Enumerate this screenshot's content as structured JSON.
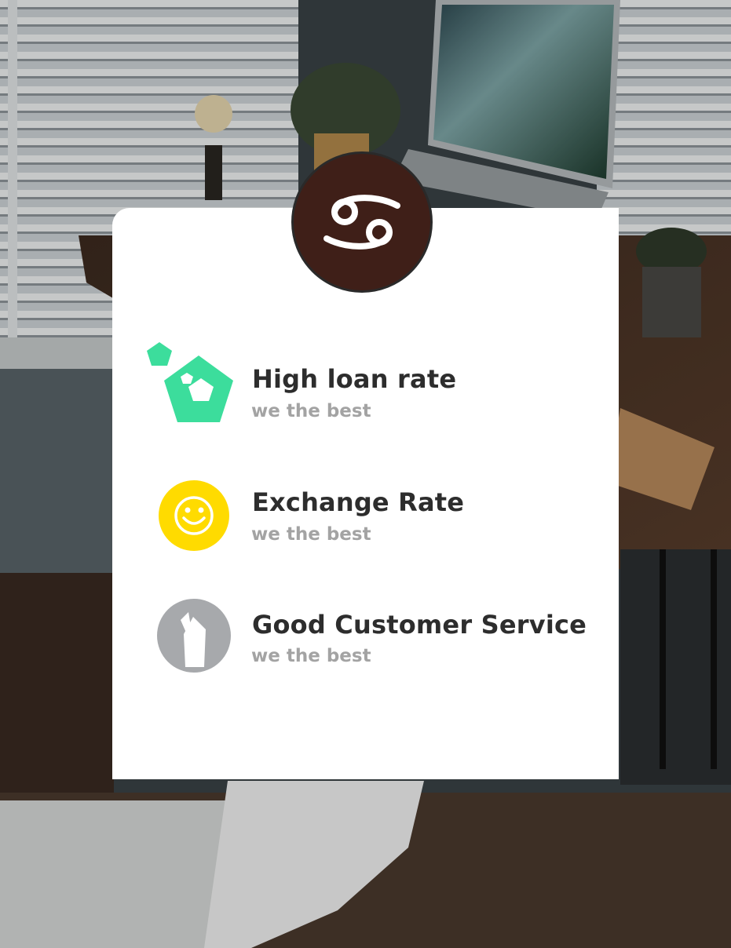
{
  "background": {
    "scene": "photo-desk-laptop-window-blinds"
  },
  "header_icon": {
    "icon": "cancer-zodiac-icon",
    "badge_color": "#3f1f18"
  },
  "features": [
    {
      "title": "High loan rate",
      "subtitle": "we the best",
      "icon": "pentagon-gem-icon",
      "color": "#3cdd9c"
    },
    {
      "title": "Exchange Rate",
      "subtitle": "we the best",
      "icon": "smiley-face-icon",
      "color": "#ffdb00"
    },
    {
      "title": "Good Customer Service",
      "subtitle": "we the best",
      "icon": "pen-nib-icon",
      "color": "#a7a9ac"
    }
  ],
  "colors": {
    "title": "#2d2d2d",
    "subtitle": "#a3a3a3",
    "card": "#ffffff"
  }
}
